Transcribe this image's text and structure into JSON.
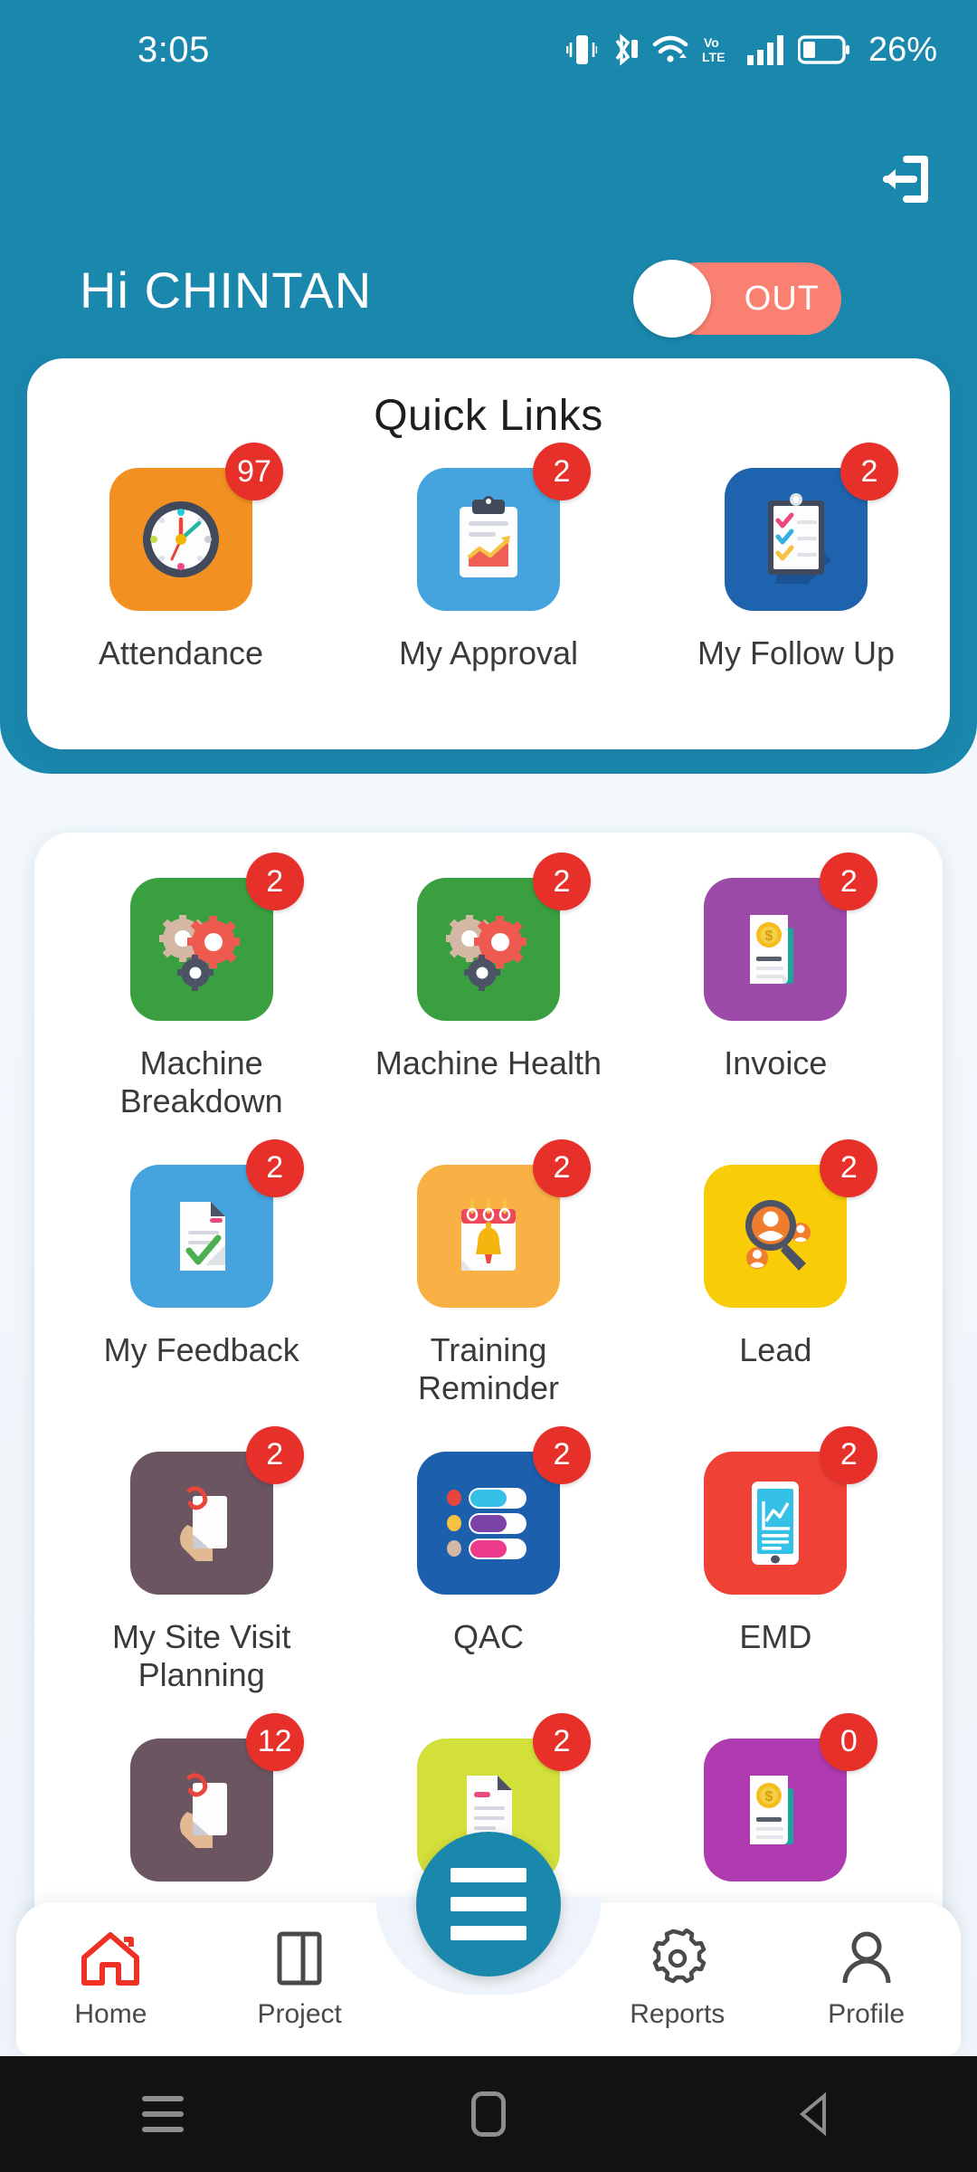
{
  "statusbar": {
    "time": "3:05",
    "battery_percent": "26%",
    "icons": [
      "vibrate-icon",
      "bluetooth-icon",
      "wifi-icon",
      "volte-icon",
      "signal-icon",
      "battery-icon"
    ]
  },
  "header": {
    "greeting": "Hi CHINTAN",
    "logout_icon": "logout-icon",
    "attendance_toggle": {
      "label": "OUT",
      "state": "out",
      "track_color": "#fa8072"
    },
    "background_color": "#1a87ad"
  },
  "quick_links": {
    "title": "Quick Links",
    "items": [
      {
        "label": "Attendance",
        "badge": "97",
        "tile_color": "#f29121",
        "icon": "clock-icon"
      },
      {
        "label": "My Approval",
        "badge": "2",
        "tile_color": "#45a4dd",
        "icon": "clipboard-chart-icon"
      },
      {
        "label": "My Follow Up",
        "badge": "2",
        "tile_color": "#1d63ad",
        "icon": "clipboard-checklist-icon"
      }
    ]
  },
  "modules": {
    "items": [
      {
        "label": "Machine Breakdown",
        "badge": "2",
        "tile_color": "#3aa03f",
        "icon": "gears-icon"
      },
      {
        "label": "Machine Health",
        "badge": "2",
        "tile_color": "#3aa03f",
        "icon": "gears-icon"
      },
      {
        "label": "Invoice",
        "badge": "2",
        "tile_color": "#9b4aa8",
        "icon": "invoice-coin-icon"
      },
      {
        "label": "My Feedback",
        "badge": "2",
        "tile_color": "#45a4dd",
        "icon": "document-check-icon"
      },
      {
        "label": "Training Reminder",
        "badge": "2",
        "tile_color": "#f9b146",
        "icon": "calendar-bell-icon"
      },
      {
        "label": "Lead",
        "badge": "2",
        "tile_color": "#f8cc06",
        "icon": "search-people-icon"
      },
      {
        "label": "My Site Visit Planning",
        "badge": "2",
        "tile_color": "#6b5560",
        "icon": "hand-document-icon"
      },
      {
        "label": "QAC",
        "badge": "2",
        "tile_color": "#1b5fad",
        "icon": "toggle-list-icon"
      },
      {
        "label": "EMD",
        "badge": "2",
        "tile_color": "#ef4136",
        "icon": "tablet-chart-icon"
      },
      {
        "label": "",
        "badge": "12",
        "tile_color": "#6b5560",
        "icon": "hand-document-icon"
      },
      {
        "label": "",
        "badge": "2",
        "tile_color": "#d4e03a",
        "icon": "document-icon"
      },
      {
        "label": "",
        "badge": "0",
        "tile_color": "#b03ab0",
        "icon": "invoice-coin-icon"
      }
    ],
    "badge_color": "#e8302a"
  },
  "fab": {
    "icon": "menu-icon",
    "color": "#1a87ad"
  },
  "bottom_nav": {
    "items": [
      {
        "label": "Home",
        "icon": "home-icon",
        "active": true
      },
      {
        "label": "Project",
        "icon": "book-icon",
        "active": false
      },
      {
        "label": "Reports",
        "icon": "gear-icon",
        "active": false
      },
      {
        "label": "Profile",
        "icon": "person-icon",
        "active": false
      }
    ],
    "active_color": "#ee3124"
  },
  "android_nav": {
    "items": [
      "recents-icon",
      "home-square-icon",
      "back-icon"
    ]
  }
}
